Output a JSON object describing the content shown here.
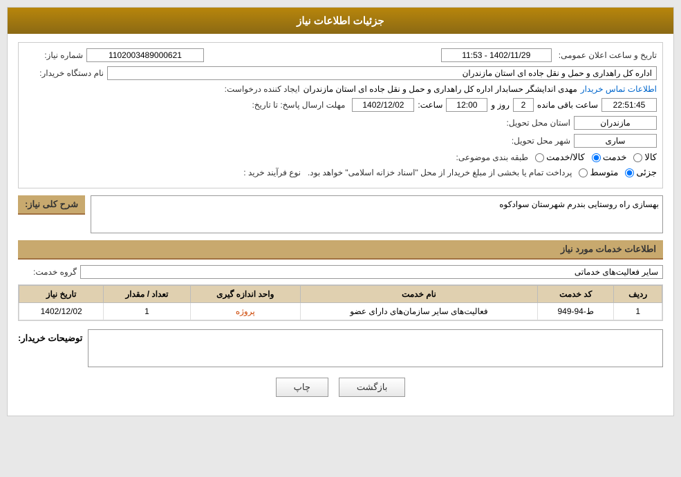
{
  "header": {
    "title": "جزئیات اطلاعات نیاز"
  },
  "main": {
    "fields": {
      "shomara_niaz_label": "شماره نیاز:",
      "shomara_niaz_value": "1102003489000621",
      "tarikh_label": "تاریخ و ساعت اعلان عمومی:",
      "tarikh_value": "1402/11/29 - 11:53",
      "nam_dastgah_label": "نام دستگاه خریدار:",
      "nam_dastgah_value": "اداره کل راهداری و حمل و نقل جاده ای استان مازندران",
      "ijad_konande_label": "ایجاد کننده درخواست:",
      "ijad_konande_name": "مهدی اندایشگر حسابدار اداره کل راهداری و حمل و نقل جاده ای استان مازندران",
      "ijad_konande_link": "اطلاعات تماس خریدار",
      "mohlat_label": "مهلت ارسال پاسخ: تا تاریخ:",
      "mohlat_date": "1402/12/02",
      "mohlat_time": "12:00",
      "mohlat_days": "2",
      "mohlat_time_remain": "22:51:45",
      "mohlat_unit_label": "ساعت باقی مانده",
      "mohlat_roz_label": "روز و",
      "mohlat_saat_label": "ساعت:",
      "ostan_label": "استان محل تحویل:",
      "ostan_value": "مازندران",
      "shahr_label": "شهر محل تحویل:",
      "shahr_value": "ساری",
      "tabaqeh_label": "طبقه بندی موضوعی:",
      "radio_kala": "کالا",
      "radio_khedmat": "خدمت",
      "radio_kala_khedmat": "کالا/خدمت",
      "selected_radio": "خدمت",
      "nooe_farayand_label": "نوع فرآیند خرید :",
      "radio_jozee": "جزئی",
      "radio_mootavaset": "متوسط",
      "farayand_note": "پرداخت تمام یا بخشی از مبلغ خریدار از محل \"اسناد خزانه اسلامی\" خواهد بود.",
      "sharh_label": "شرح کلی نیاز:",
      "sharh_value": "بهسازی راه روستایی بندرم شهرستان سوادکوه",
      "khedamat_section_title": "اطلاعات خدمات مورد نیاز",
      "goroh_khedmat_label": "گروه خدمت:",
      "goroh_khedmat_value": "سایر فعالیت‌های خدماتی",
      "table": {
        "headers": [
          "ردیف",
          "کد خدمت",
          "نام خدمت",
          "واحد اندازه گیری",
          "تعداد / مقدار",
          "تاریخ نیاز"
        ],
        "rows": [
          {
            "radif": "1",
            "kod": "ط-94-949",
            "nam": "فعالیت‌های سایر سازمان‌های دارای عضو",
            "vahed": "پروژه",
            "tedad": "1",
            "tarikh": "1402/12/02"
          }
        ]
      },
      "tosihaat_label": "توضیحات خریدار:",
      "tosihaat_value": ""
    },
    "buttons": {
      "print": "چاپ",
      "back": "بازگشت"
    }
  }
}
